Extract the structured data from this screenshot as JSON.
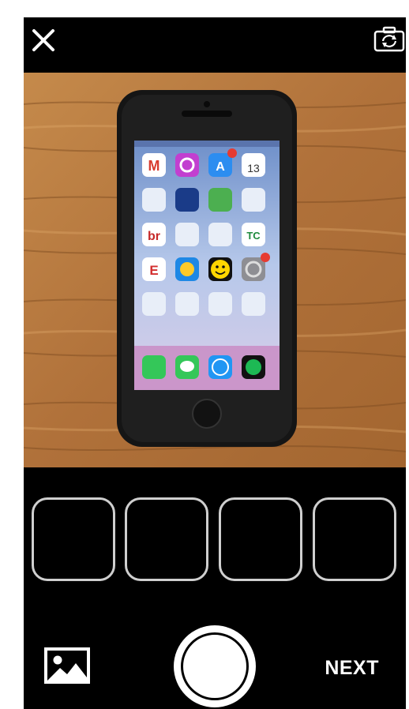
{
  "header": {
    "close_icon": "close-icon",
    "flip_camera_icon": "camera-flip-icon"
  },
  "preview": {
    "subject": "photo of a smartphone lying on a wooden table",
    "phone_dock_apps": [
      "Phone",
      "Messages",
      "Safari",
      "Spotify"
    ],
    "calendar_day": "13"
  },
  "thumbnails": [
    {
      "slot": 1,
      "filled": false
    },
    {
      "slot": 2,
      "filled": false
    },
    {
      "slot": 3,
      "filled": false
    },
    {
      "slot": 4,
      "filled": false
    }
  ],
  "footer": {
    "gallery_icon": "image-gallery-icon",
    "shutter_icon": "shutter-button",
    "next_label": "NEXT"
  },
  "colors": {
    "background": "#000000",
    "thumb_border": "#cfcfcf",
    "text": "#ffffff",
    "wood": "#b5773a"
  }
}
